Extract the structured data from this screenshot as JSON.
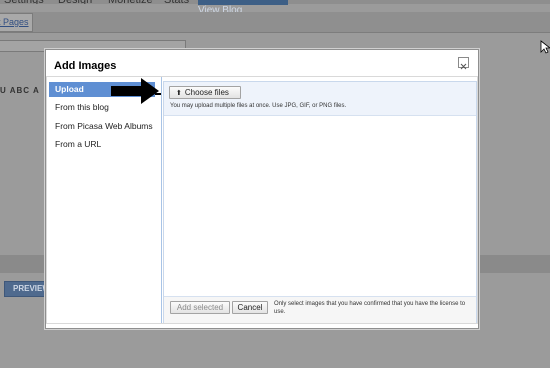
{
  "background": {
    "tabs": [
      "Settings",
      "Design",
      "Monetize",
      "Stats"
    ],
    "active_tab": "View Blog",
    "edit_pages_link": "it Pages",
    "toolbar_glyphs": "U ABC A",
    "preview_label": "PREVIEW"
  },
  "dialog": {
    "title": "Add Images",
    "close_glyph": "×",
    "sidebar": {
      "items": [
        {
          "label": "Upload",
          "active": true
        },
        {
          "label": "From this blog"
        },
        {
          "label": "From Picasa Web Albums"
        },
        {
          "label": "From a URL"
        }
      ]
    },
    "upload": {
      "choose_label": "Choose files",
      "hint": "You may upload multiple files at once. Use JPG, GIF, or PNG files."
    },
    "footer": {
      "add_label": "Add selected",
      "cancel_label": "Cancel",
      "notice": "Only select images that you have confirmed that you have the license to use."
    }
  },
  "colors": {
    "overlay": "#9b9b9b",
    "active_item": "#5f8fd3",
    "panel_border": "#a9c4e6"
  },
  "icons": {
    "choose_icon": "upload-icon",
    "annotation": "arrow-right-icon",
    "pointer": "mouse-cursor-icon"
  }
}
